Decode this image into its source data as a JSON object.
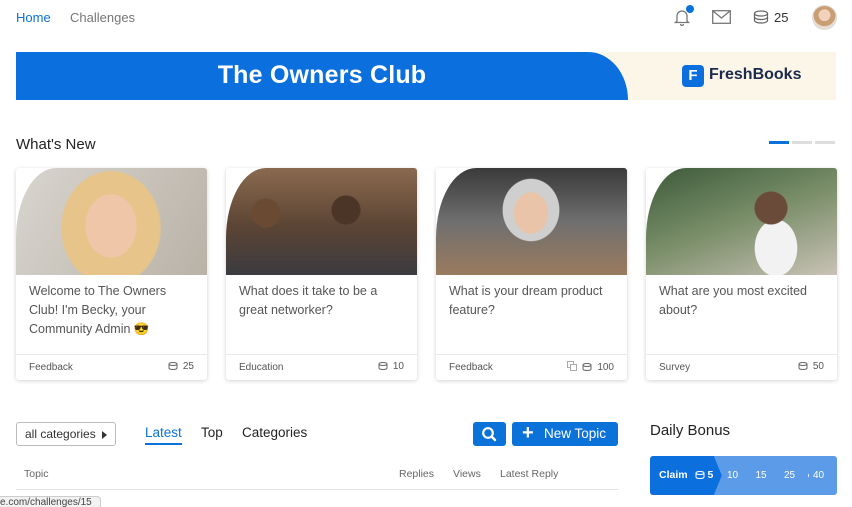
{
  "nav": {
    "home": "Home",
    "challenges": "Challenges",
    "coin_count": "25"
  },
  "banner": {
    "title": "The Owners Club",
    "sponsor": "FreshBooks",
    "sponsor_logo_letter": "F"
  },
  "whats_new": {
    "title": "What's New",
    "cards": [
      {
        "text": "Welcome to The Owners Club! I'm Becky, your Community Admin 😎",
        "category": "Feedback",
        "points": "25"
      },
      {
        "text": "What does it take to be a great networker?",
        "category": "Education",
        "points": "10"
      },
      {
        "text": "What is your dream product feature?",
        "category": "Feedback",
        "points": "100"
      },
      {
        "text": "What are you most excited about?",
        "category": "Survey",
        "points": "50"
      }
    ]
  },
  "topics": {
    "category_select": "all categories",
    "tabs": [
      "Latest",
      "Top",
      "Categories"
    ],
    "new_topic": "New Topic",
    "columns": [
      "Topic",
      "Replies",
      "Views",
      "Latest Reply"
    ]
  },
  "daily_bonus": {
    "title": "Daily Bonus",
    "claim_label": "Claim",
    "claim_value": "5",
    "steps": [
      "10",
      "15",
      "25",
      "40"
    ]
  },
  "status_url": "e.com/challenges/15",
  "colors": {
    "accent": "#0b72d9",
    "banner_blue": "#0b6fde",
    "bonus_step": "#5c9be8"
  }
}
